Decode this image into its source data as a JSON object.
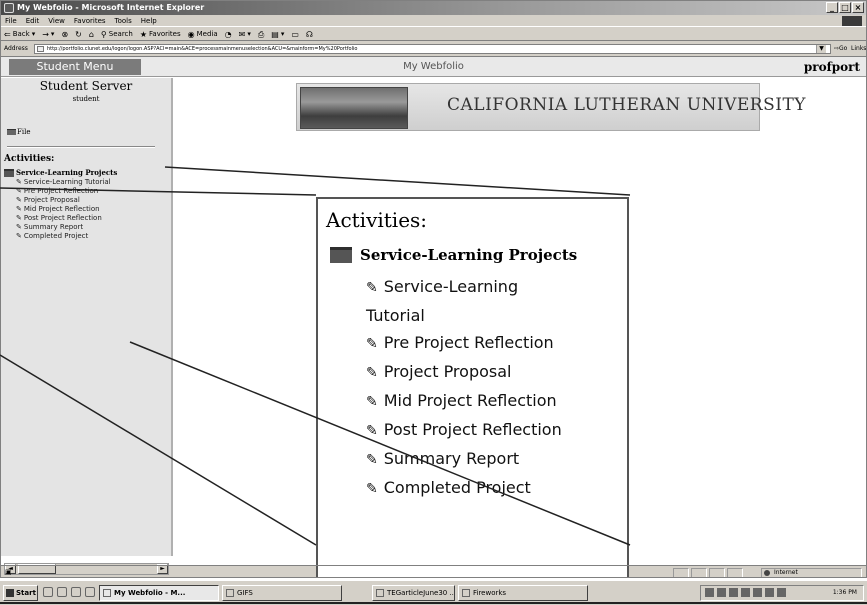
{
  "window": {
    "title": "My Webfolio - Microsoft Internet Explorer",
    "min_glyph": "_",
    "max_glyph": "□",
    "close_glyph": "×"
  },
  "menu": [
    "File",
    "Edit",
    "View",
    "Favorites",
    "Tools",
    "Help"
  ],
  "toolbar": {
    "back": "Back",
    "forward": "→",
    "search": "Search",
    "favorites": "Favorites",
    "media": "Media"
  },
  "address": {
    "label": "Address",
    "url": "http://portfolio.clunet.edu/logon/logon.ASP?ACI=main&ACE=processmainmenuselection&ACU=&mainform=My%20Portfolio",
    "go": "Go",
    "links": "Links »"
  },
  "header": {
    "student_menu": "Student Menu",
    "center_title": "My Webfolio",
    "right_title": "profport"
  },
  "sidebar": {
    "server_title": "Student Server",
    "server_sub": "student",
    "file_label": "File",
    "activities_heading": "Activities:",
    "group_label": "Service-Learning Projects",
    "items": [
      "Service-Learning Tutorial",
      "Pre Project Reflection",
      "Project Proposal",
      "Mid Project Reflection",
      "Post Project Reflection",
      "Summary Report",
      "Completed Project"
    ]
  },
  "banner": {
    "university": "CALIFORNIA LUTHERAN UNIVERSITY"
  },
  "callout": {
    "heading": "Activities:",
    "group_label": "Service-Learning Projects",
    "items": [
      "Service-Learning Tutorial",
      "Pre Project Reflection",
      "Project Proposal",
      "Mid Project Reflection",
      "Post Project Reflection",
      "Summary Report",
      "Completed Project"
    ]
  },
  "status": {
    "zone": "Internet"
  },
  "taskbar": {
    "start": "Start",
    "tasks": [
      "My Webfolio - M...",
      "GIFS",
      "TEGarticleJune30 ...",
      "Fireworks"
    ],
    "clock": "1:36 PM"
  }
}
